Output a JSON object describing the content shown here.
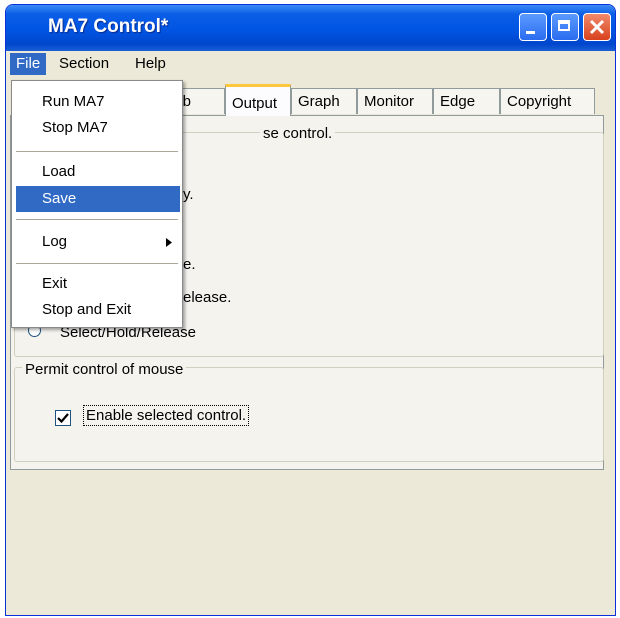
{
  "window": {
    "title": "MA7 Control*"
  },
  "menubar": {
    "file": "File",
    "section": "Section",
    "help": "Help"
  },
  "file_menu": {
    "run": "Run MA7",
    "stop": "Stop MA7",
    "load": "Load",
    "save": "Save",
    "log": "Log",
    "exit": "Exit",
    "stop_exit": "Stop and Exit"
  },
  "tabs": {
    "calib": "lib",
    "output": "Output",
    "graph": "Graph",
    "monitor": "Monitor",
    "edge": "Edge",
    "copyright": "Copyright"
  },
  "group1": {
    "legend_partial": "se control.",
    "fragment_1": "y.",
    "fragment_2": "e.",
    "fragment_3": "elease.",
    "radio_label": "Select/Hold/Release"
  },
  "group2": {
    "legend": "Permit control of mouse",
    "checkbox_label": "Enable selected control.",
    "checkbox_checked": true
  },
  "colors": {
    "selection": "#316ac5",
    "titlebar": "#0054e3",
    "face": "#ece9d8"
  }
}
